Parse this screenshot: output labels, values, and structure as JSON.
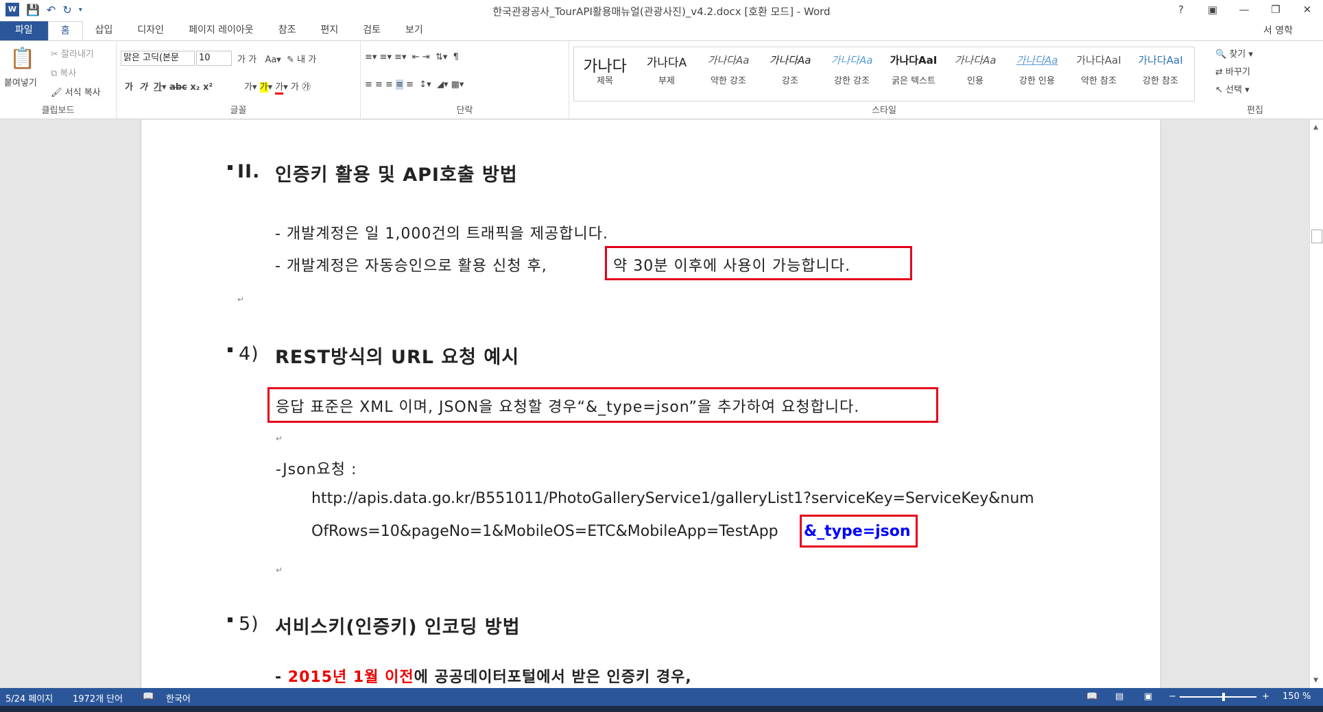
{
  "window": {
    "title": "한국관광공사_TourAPI활용매뉴얼(관광사진)_v4.2.docx [호환 모드] - Word",
    "logo": "W"
  },
  "tabs": [
    "파일",
    "홈",
    "삽입",
    "디자인",
    "페이지 레이아웃",
    "참조",
    "편지",
    "검토",
    "보기"
  ],
  "user": "서 영학",
  "clipboard": {
    "paste": "붙여넣기",
    "cut": "잘라내기",
    "copy": "복사",
    "format": "서식 복사",
    "label": "클립보드"
  },
  "font": {
    "name": "맑은 고딕(본문",
    "size": "10",
    "label": "글꼴"
  },
  "paragraph": {
    "label": "단락"
  },
  "styles": {
    "label": "스타일",
    "items": [
      {
        "preview": "가나다",
        "name": "제목"
      },
      {
        "preview": "가나다A",
        "name": "부제"
      },
      {
        "preview": "가나다Aa",
        "name": "약한 강조"
      },
      {
        "preview": "가나다Aa",
        "name": "강조"
      },
      {
        "preview": "가나다Aa",
        "name": "강한 강조"
      },
      {
        "preview": "가나다AaI",
        "name": "굵은 텍스트"
      },
      {
        "preview": "가나다Aa",
        "name": "인용"
      },
      {
        "preview": "가나다Aa",
        "name": "강한 인용"
      },
      {
        "preview": "가나다AaI",
        "name": "약한 참조"
      },
      {
        "preview": "가나다AaI",
        "name": "강한 참조"
      }
    ]
  },
  "editing": {
    "find": "찾기",
    "replace": "바꾸기",
    "select": "선택",
    "label": "편집"
  },
  "document": {
    "h1_num": "II.",
    "h1": "인증키 활용 및 API호출 방법",
    "line1": "- 개발계정은 일 1,000건의 트래픽을 제공합니다.",
    "line2a": "- 개발계정은 자동승인으로 활용 신청 후, ",
    "line2b": "약 30분 이후에 사용이 가능합니다.",
    "h2_num": "4)",
    "h2": "REST방식의 URL 요청 예시",
    "line3": "응답 표준은 XML 이며, JSON을 요청할 경우“&_type=json”을 추가하여 요청합니다.",
    "line4": "-Json요청 :",
    "url1": "http://apis.data.go.kr/B551011/PhotoGalleryService1/galleryList1?serviceKey=ServiceKey&num",
    "url2a": "OfRows=10&pageNo=1&MobileOS=ETC&MobileApp=TestApp",
    "url2b": "&_type=json",
    "h3_num": "5)",
    "h3": "서비스키(인증키) 인코딩 방법",
    "line5_prefix": "- ",
    "line5_red": "2015년 1월 이전",
    "line5_rest": "에 공공데이터포털에서 받은 인증키 경우,",
    "pm": "↵"
  },
  "status": {
    "page": "5/24 페이지",
    "words": "1972개 단어",
    "lang": "한국어",
    "zoom": "150 %"
  }
}
